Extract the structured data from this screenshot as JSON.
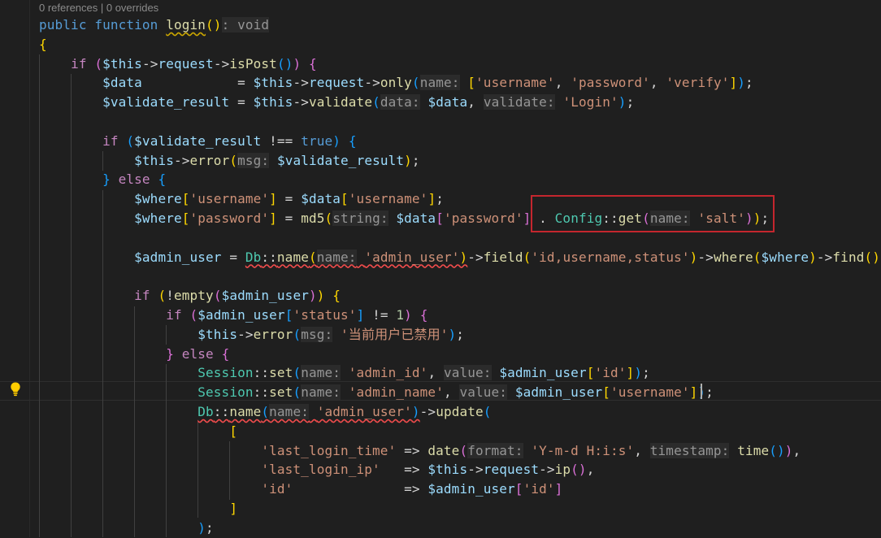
{
  "codelens": "0 references | 0 overrides",
  "lines": [
    [
      [
        "k",
        "public "
      ],
      [
        "k",
        "function "
      ],
      [
        "f sqy",
        "login"
      ],
      [
        "b1",
        "()"
      ],
      [
        "h",
        ": void"
      ]
    ],
    [
      [
        "b1",
        "{"
      ]
    ],
    [
      [
        "p",
        "    "
      ],
      [
        "c",
        "if "
      ],
      [
        "b2",
        "("
      ],
      [
        "v",
        "$this"
      ],
      [
        "p",
        "->"
      ],
      [
        "v",
        "request"
      ],
      [
        "p",
        "->"
      ],
      [
        "f",
        "isPost"
      ],
      [
        "b3",
        "()"
      ],
      [
        "b2",
        ")"
      ],
      [
        "p",
        " "
      ],
      [
        "b2",
        "{"
      ]
    ],
    [
      [
        "p",
        "        "
      ],
      [
        "v",
        "$data"
      ],
      [
        "p",
        "            = "
      ],
      [
        "v",
        "$this"
      ],
      [
        "p",
        "->"
      ],
      [
        "v",
        "request"
      ],
      [
        "p",
        "->"
      ],
      [
        "f",
        "only"
      ],
      [
        "b3",
        "("
      ],
      [
        "h",
        "name:"
      ],
      [
        "p",
        " "
      ],
      [
        "b1",
        "["
      ],
      [
        "s",
        "'username'"
      ],
      [
        "p",
        ", "
      ],
      [
        "s",
        "'password'"
      ],
      [
        "p",
        ", "
      ],
      [
        "s",
        "'verify'"
      ],
      [
        "b1",
        "]"
      ],
      [
        "b3",
        ")"
      ],
      [
        "p",
        ";"
      ]
    ],
    [
      [
        "p",
        "        "
      ],
      [
        "v",
        "$validate_result"
      ],
      [
        "p",
        " = "
      ],
      [
        "v",
        "$this"
      ],
      [
        "p",
        "->"
      ],
      [
        "f",
        "validate"
      ],
      [
        "b3",
        "("
      ],
      [
        "h",
        "data:"
      ],
      [
        "p",
        " "
      ],
      [
        "v",
        "$data"
      ],
      [
        "p",
        ", "
      ],
      [
        "h",
        "validate:"
      ],
      [
        "p",
        " "
      ],
      [
        "s",
        "'Login'"
      ],
      [
        "b3",
        ")"
      ],
      [
        "p",
        ";"
      ]
    ],
    [],
    [
      [
        "p",
        "        "
      ],
      [
        "c",
        "if "
      ],
      [
        "b3",
        "("
      ],
      [
        "v",
        "$validate_result"
      ],
      [
        "p",
        " !== "
      ],
      [
        "k",
        "true"
      ],
      [
        "b3",
        ")"
      ],
      [
        "p",
        " "
      ],
      [
        "b3",
        "{"
      ]
    ],
    [
      [
        "p",
        "            "
      ],
      [
        "v",
        "$this"
      ],
      [
        "p",
        "->"
      ],
      [
        "f",
        "error"
      ],
      [
        "b1",
        "("
      ],
      [
        "h",
        "msg:"
      ],
      [
        "p",
        " "
      ],
      [
        "v",
        "$validate_result"
      ],
      [
        "b1",
        ")"
      ],
      [
        "p",
        ";"
      ]
    ],
    [
      [
        "p",
        "        "
      ],
      [
        "b3",
        "}"
      ],
      [
        "p",
        " "
      ],
      [
        "c",
        "else "
      ],
      [
        "b3",
        "{"
      ]
    ],
    [
      [
        "p",
        "            "
      ],
      [
        "v",
        "$where"
      ],
      [
        "b1",
        "["
      ],
      [
        "s",
        "'username'"
      ],
      [
        "b1",
        "]"
      ],
      [
        "p",
        " = "
      ],
      [
        "v",
        "$data"
      ],
      [
        "b1",
        "["
      ],
      [
        "s",
        "'username'"
      ],
      [
        "b1",
        "]"
      ],
      [
        "p",
        ";"
      ]
    ],
    [
      [
        "p",
        "            "
      ],
      [
        "v",
        "$where"
      ],
      [
        "b1",
        "["
      ],
      [
        "s",
        "'password'"
      ],
      [
        "b1",
        "]"
      ],
      [
        "p",
        " = "
      ],
      [
        "f",
        "md5"
      ],
      [
        "b1",
        "("
      ],
      [
        "h",
        "string:"
      ],
      [
        "p",
        " "
      ],
      [
        "v",
        "$data"
      ],
      [
        "b2",
        "["
      ],
      [
        "s",
        "'password'"
      ],
      [
        "b2",
        "]"
      ],
      [
        "p",
        " . "
      ],
      [
        "t",
        "Config"
      ],
      [
        "p",
        "::"
      ],
      [
        "f",
        "get"
      ],
      [
        "b2",
        "("
      ],
      [
        "h",
        "name:"
      ],
      [
        "p",
        " "
      ],
      [
        "s",
        "'salt'"
      ],
      [
        "b2",
        ")"
      ],
      [
        "b1",
        ")"
      ],
      [
        "p",
        ";"
      ]
    ],
    [],
    [
      [
        "p",
        "            "
      ],
      [
        "v",
        "$admin_user"
      ],
      [
        "p",
        " = "
      ],
      [
        "t sq",
        "Db"
      ],
      [
        "p sq",
        "::"
      ],
      [
        "f sq",
        "name"
      ],
      [
        "b1 sq",
        "("
      ],
      [
        "h sq",
        "name:"
      ],
      [
        "p sq",
        " "
      ],
      [
        "s sq",
        "'admin_user'"
      ],
      [
        "b1 sq",
        ")"
      ],
      [
        "p",
        "->"
      ],
      [
        "f",
        "field"
      ],
      [
        "b1",
        "("
      ],
      [
        "s",
        "'id,username,status'"
      ],
      [
        "b1",
        ")"
      ],
      [
        "p",
        "->"
      ],
      [
        "f",
        "where"
      ],
      [
        "b1",
        "("
      ],
      [
        "v",
        "$where"
      ],
      [
        "b1",
        ")"
      ],
      [
        "p",
        "->"
      ],
      [
        "f",
        "find"
      ],
      [
        "b1",
        "()"
      ],
      [
        "p",
        ";"
      ]
    ],
    [],
    [
      [
        "p",
        "            "
      ],
      [
        "c",
        "if "
      ],
      [
        "b1",
        "("
      ],
      [
        "p",
        "!"
      ],
      [
        "f",
        "empty"
      ],
      [
        "b2",
        "("
      ],
      [
        "v",
        "$admin_user"
      ],
      [
        "b2",
        ")"
      ],
      [
        "b1",
        ")"
      ],
      [
        "p",
        " "
      ],
      [
        "b1",
        "{"
      ]
    ],
    [
      [
        "p",
        "                "
      ],
      [
        "c",
        "if "
      ],
      [
        "b2",
        "("
      ],
      [
        "v",
        "$admin_user"
      ],
      [
        "b3",
        "["
      ],
      [
        "s",
        "'status'"
      ],
      [
        "b3",
        "]"
      ],
      [
        "p",
        " != "
      ],
      [
        "n",
        "1"
      ],
      [
        "b2",
        ")"
      ],
      [
        "p",
        " "
      ],
      [
        "b2",
        "{"
      ]
    ],
    [
      [
        "p",
        "                    "
      ],
      [
        "v",
        "$this"
      ],
      [
        "p",
        "->"
      ],
      [
        "f",
        "error"
      ],
      [
        "b3",
        "("
      ],
      [
        "h",
        "msg:"
      ],
      [
        "p",
        " "
      ],
      [
        "s",
        "'当前用户已禁用'"
      ],
      [
        "b3",
        ")"
      ],
      [
        "p",
        ";"
      ]
    ],
    [
      [
        "p",
        "                "
      ],
      [
        "b2",
        "}"
      ],
      [
        "p",
        " "
      ],
      [
        "c",
        "else "
      ],
      [
        "b2",
        "{"
      ]
    ],
    [
      [
        "p",
        "                    "
      ],
      [
        "t",
        "Session"
      ],
      [
        "p",
        "::"
      ],
      [
        "f",
        "set"
      ],
      [
        "b3",
        "("
      ],
      [
        "h",
        "name:"
      ],
      [
        "p",
        " "
      ],
      [
        "s",
        "'admin_id'"
      ],
      [
        "p",
        ", "
      ],
      [
        "h",
        "value:"
      ],
      [
        "p",
        " "
      ],
      [
        "v",
        "$admin_user"
      ],
      [
        "b1",
        "["
      ],
      [
        "s",
        "'id'"
      ],
      [
        "b1",
        "]"
      ],
      [
        "b3",
        ")"
      ],
      [
        "p",
        ";"
      ]
    ],
    [
      [
        "p",
        "                    "
      ],
      [
        "t",
        "Session"
      ],
      [
        "p",
        "::"
      ],
      [
        "f",
        "set"
      ],
      [
        "b3",
        "("
      ],
      [
        "h",
        "name:"
      ],
      [
        "p",
        " "
      ],
      [
        "s",
        "'admin_name'"
      ],
      [
        "p",
        ", "
      ],
      [
        "h",
        "value:"
      ],
      [
        "p",
        " "
      ],
      [
        "v",
        "$admin_user"
      ],
      [
        "b1",
        "["
      ],
      [
        "s",
        "'username'"
      ],
      [
        "b1",
        "]"
      ],
      [
        "b3",
        ")"
      ],
      [
        "p",
        ";"
      ]
    ],
    [
      [
        "p",
        "                    "
      ],
      [
        "t sq",
        "Db"
      ],
      [
        "p sq",
        "::"
      ],
      [
        "f sq",
        "name"
      ],
      [
        "b3 sq",
        "("
      ],
      [
        "h sq",
        "name:"
      ],
      [
        "p sq",
        " "
      ],
      [
        "s sq",
        "'admin_user'"
      ],
      [
        "b3 sq",
        ")"
      ],
      [
        "p",
        "->"
      ],
      [
        "f",
        "update"
      ],
      [
        "b3",
        "("
      ]
    ],
    [
      [
        "p",
        "                        "
      ],
      [
        "b1",
        "["
      ]
    ],
    [
      [
        "p",
        "                            "
      ],
      [
        "s",
        "'last_login_time'"
      ],
      [
        "p",
        " => "
      ],
      [
        "f",
        "date"
      ],
      [
        "b2",
        "("
      ],
      [
        "h",
        "format:"
      ],
      [
        "p",
        " "
      ],
      [
        "s",
        "'Y-m-d H:i:s'"
      ],
      [
        "p",
        ", "
      ],
      [
        "h",
        "timestamp:"
      ],
      [
        "p",
        " "
      ],
      [
        "f",
        "time"
      ],
      [
        "b3",
        "()"
      ],
      [
        "b2",
        ")"
      ],
      [
        "p",
        ","
      ]
    ],
    [
      [
        "p",
        "                            "
      ],
      [
        "s",
        "'last_login_ip'"
      ],
      [
        "p",
        "   => "
      ],
      [
        "v",
        "$this"
      ],
      [
        "p",
        "->"
      ],
      [
        "v",
        "request"
      ],
      [
        "p",
        "->"
      ],
      [
        "f",
        "ip"
      ],
      [
        "b2",
        "()"
      ],
      [
        "p",
        ","
      ]
    ],
    [
      [
        "p",
        "                            "
      ],
      [
        "s",
        "'id'"
      ],
      [
        "p",
        "              => "
      ],
      [
        "v",
        "$admin_user"
      ],
      [
        "b2",
        "["
      ],
      [
        "s",
        "'id'"
      ],
      [
        "b2",
        "]"
      ]
    ],
    [
      [
        "p",
        "                        "
      ],
      [
        "b1",
        "]"
      ]
    ],
    [
      [
        "p",
        "                    "
      ],
      [
        "b3",
        ")"
      ],
      [
        "p",
        ";"
      ]
    ]
  ]
}
